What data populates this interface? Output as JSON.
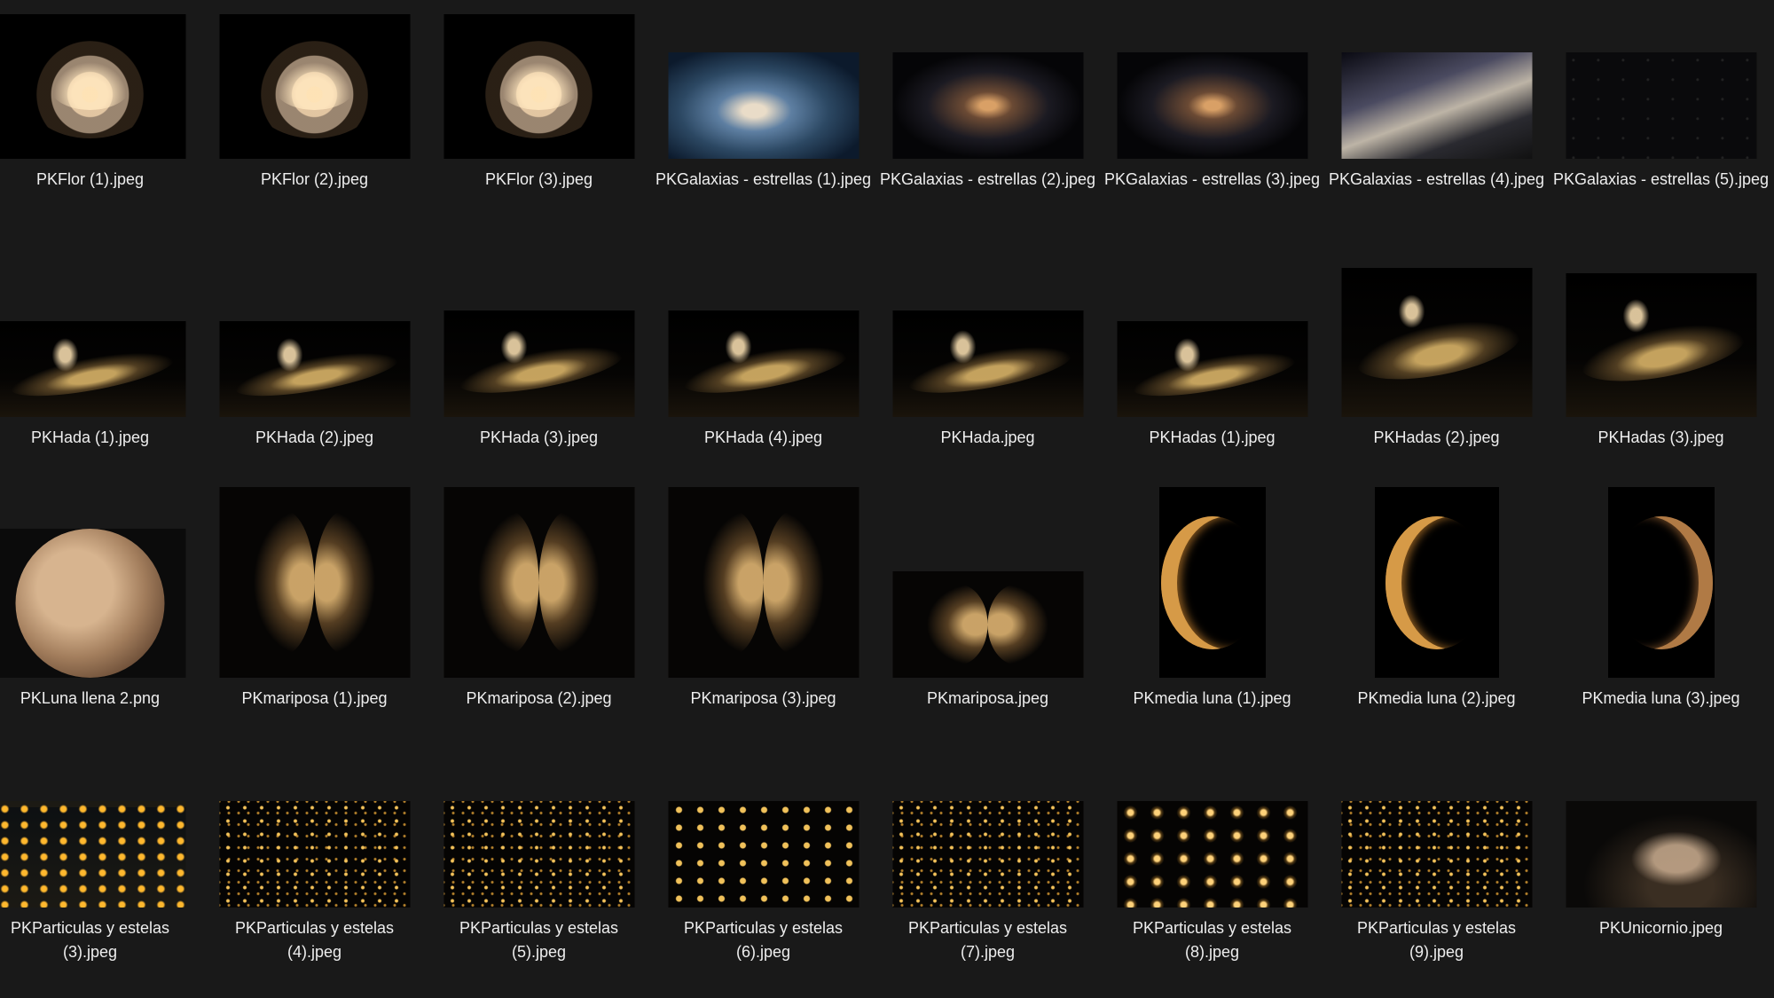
{
  "files": [
    {
      "name": "PKFlor (1).jpeg",
      "thumb": "flower"
    },
    {
      "name": "PKFlor (2).jpeg",
      "thumb": "flower"
    },
    {
      "name": "PKFlor (3).jpeg",
      "thumb": "flower"
    },
    {
      "name": "PKGalaxias - estrellas (1).jpeg",
      "thumb": "galaxy"
    },
    {
      "name": "PKGalaxias - estrellas (2).jpeg",
      "thumb": "galaxy"
    },
    {
      "name": "PKGalaxias - estrellas (3).jpeg",
      "thumb": "galaxy"
    },
    {
      "name": "PKGalaxias - estrellas (4).jpeg",
      "thumb": "galaxy"
    },
    {
      "name": "PKGalaxias - estrellas (5).jpeg",
      "thumb": "galaxy"
    },
    {
      "name": "PKHada (1).jpeg",
      "thumb": "fairy"
    },
    {
      "name": "PKHada (2).jpeg",
      "thumb": "fairy"
    },
    {
      "name": "PKHada (3).jpeg",
      "thumb": "fairy"
    },
    {
      "name": "PKHada (4).jpeg",
      "thumb": "fairy"
    },
    {
      "name": "PKHada.jpeg",
      "thumb": "fairy"
    },
    {
      "name": "PKHadas (1).jpeg",
      "thumb": "fairy"
    },
    {
      "name": "PKHadas (2).jpeg",
      "thumb": "fairy"
    },
    {
      "name": "PKHadas (3).jpeg",
      "thumb": "fairy"
    },
    {
      "name": "PKLuna llena 2.png",
      "thumb": "moon"
    },
    {
      "name": "PKmariposa (1).jpeg",
      "thumb": "butterfly"
    },
    {
      "name": "PKmariposa (2).jpeg",
      "thumb": "butterfly"
    },
    {
      "name": "PKmariposa (3).jpeg",
      "thumb": "butterfly"
    },
    {
      "name": "PKmariposa.jpeg",
      "thumb": "butterfly"
    },
    {
      "name": "PKmedia luna (1).jpeg",
      "thumb": "crescent"
    },
    {
      "name": "PKmedia luna (2).jpeg",
      "thumb": "crescent"
    },
    {
      "name": "PKmedia luna (3).jpeg",
      "thumb": "crescent"
    },
    {
      "name": "PKParticulas y estelas (3).jpeg",
      "thumb": "particles"
    },
    {
      "name": "PKParticulas y estelas (4).jpeg",
      "thumb": "particles"
    },
    {
      "name": "PKParticulas y estelas (5).jpeg",
      "thumb": "particles"
    },
    {
      "name": "PKParticulas y estelas (6).jpeg",
      "thumb": "particles"
    },
    {
      "name": "PKParticulas y estelas (7).jpeg",
      "thumb": "particles"
    },
    {
      "name": "PKParticulas y estelas (8).jpeg",
      "thumb": "particles"
    },
    {
      "name": "PKParticulas y estelas (9).jpeg",
      "thumb": "particles"
    },
    {
      "name": "PKUnicornio.jpeg",
      "thumb": "unicorn"
    }
  ]
}
